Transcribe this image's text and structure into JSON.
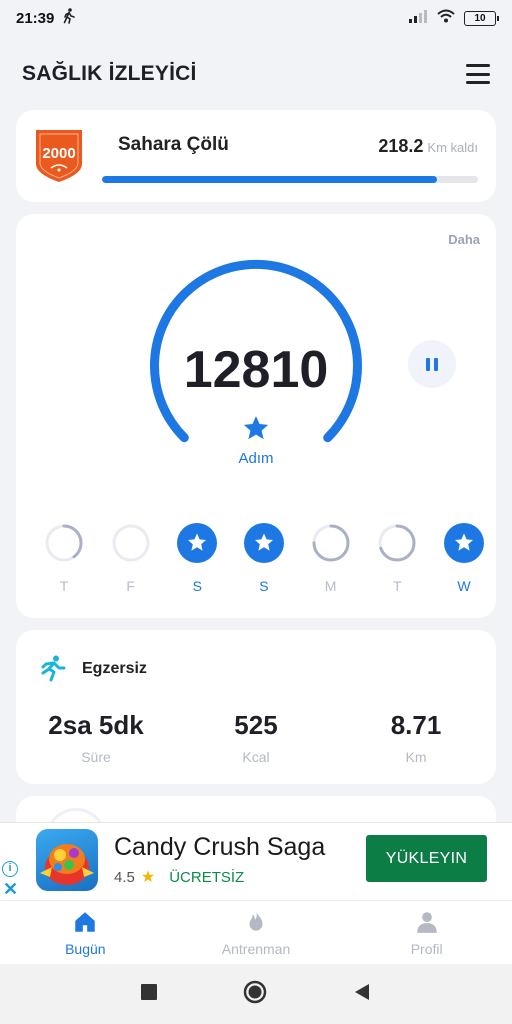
{
  "status_bar": {
    "time": "21:39",
    "battery": "10"
  },
  "header": {
    "title": "SAĞLIK İZLEYİCİ",
    "menu_icon": "menu-icon"
  },
  "challenge": {
    "badge_text": "2000",
    "name": "Sahara Çölü",
    "distance": "218.2",
    "distance_unit": "Km kaldı",
    "progress_fraction": 0.89,
    "colors": {
      "badge": "#ea5a1f",
      "progress": "#1e78e4"
    }
  },
  "steps": {
    "more_label": "Daha",
    "count": "12810",
    "unit_label": "Adım",
    "gauge_fraction": 1.0,
    "days": [
      {
        "label": "T",
        "state": "partial",
        "fraction": 0.4
      },
      {
        "label": "F",
        "state": "empty",
        "fraction": 0
      },
      {
        "label": "S",
        "state": "complete",
        "fraction": 1
      },
      {
        "label": "S",
        "state": "complete",
        "fraction": 1
      },
      {
        "label": "M",
        "state": "partial",
        "fraction": 0.75
      },
      {
        "label": "T",
        "state": "partial",
        "fraction": 0.7
      },
      {
        "label": "W",
        "state": "complete",
        "fraction": 1
      }
    ]
  },
  "exercise": {
    "title": "Egzersiz",
    "stats": [
      {
        "value": "2sa 5dk",
        "label": "Süre"
      },
      {
        "value": "525",
        "label": "Kcal"
      },
      {
        "value": "8.71",
        "label": "Km"
      }
    ]
  },
  "ad": {
    "title": "Candy Crush Saga",
    "rating": "4.5",
    "price": "ÜCRETSİZ",
    "cta": "YÜKLEYIN"
  },
  "bottom_nav": [
    {
      "label": "Bugün",
      "icon": "home-icon",
      "active": true
    },
    {
      "label": "Antrenman",
      "icon": "flame-icon",
      "active": false
    },
    {
      "label": "Profil",
      "icon": "person-icon",
      "active": false
    }
  ],
  "colors": {
    "accent": "#1e78e4",
    "muted": "#b4b9c4",
    "background": "#f2f3f7"
  }
}
